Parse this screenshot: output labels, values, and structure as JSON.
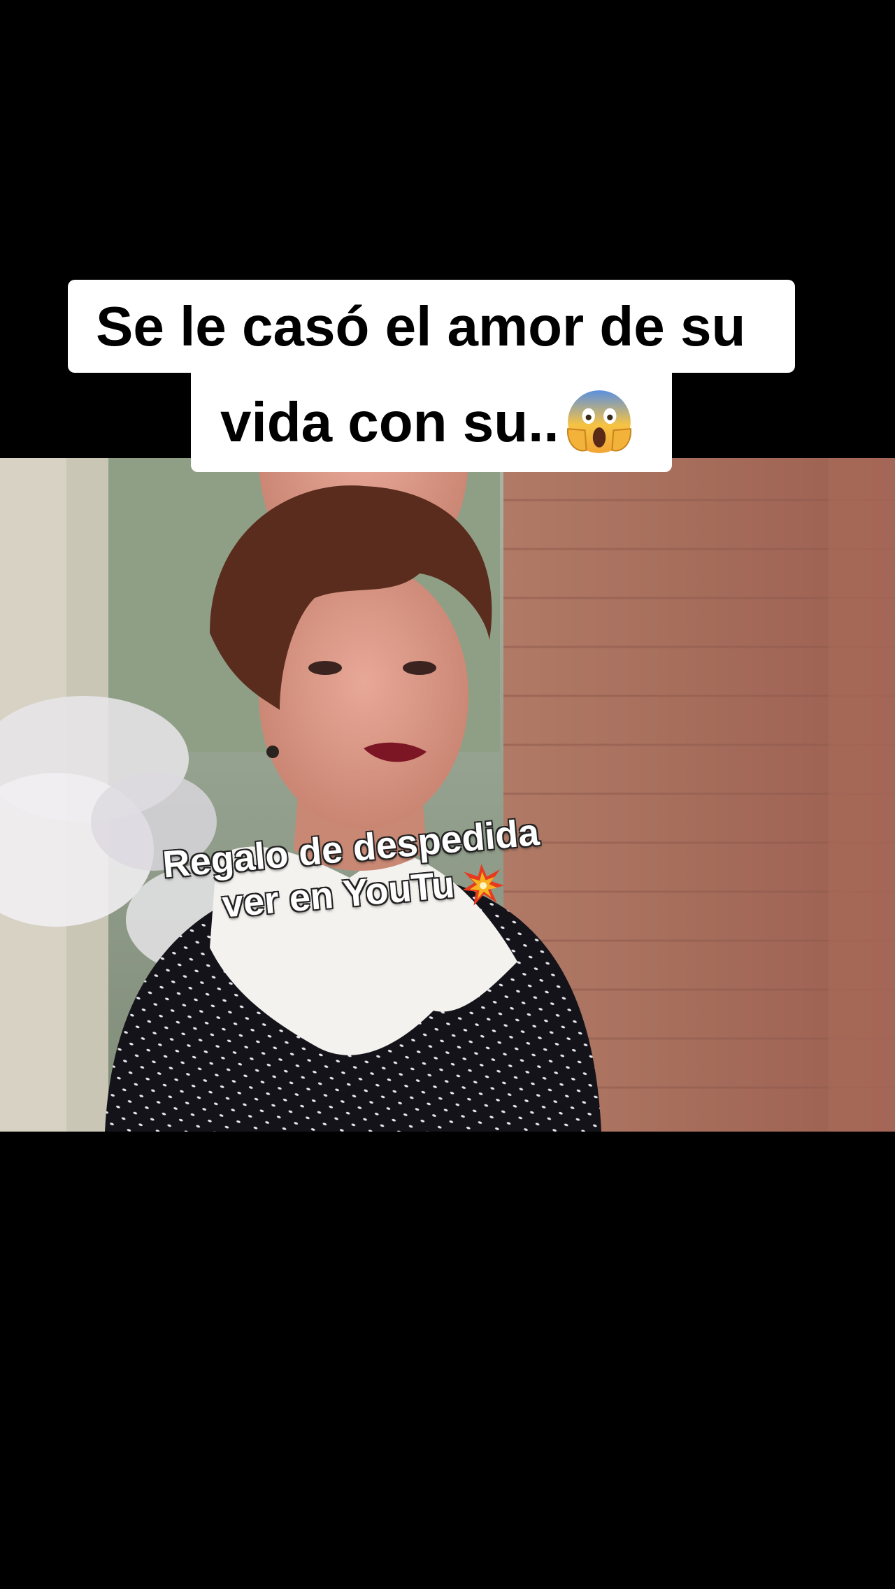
{
  "caption": {
    "line1": "Se le casó el amor de su",
    "line2": "vida con su..",
    "emoji": "face-screaming-in-fear-icon"
  },
  "overlay": {
    "line1": "Regalo de despedida",
    "line2": "ver en YouTu",
    "emoji": "collision-burst-icon"
  },
  "colors": {
    "background": "#000000",
    "caption_bg": "#ffffff",
    "caption_text": "#000000",
    "overlay_text": "#ffffff"
  }
}
